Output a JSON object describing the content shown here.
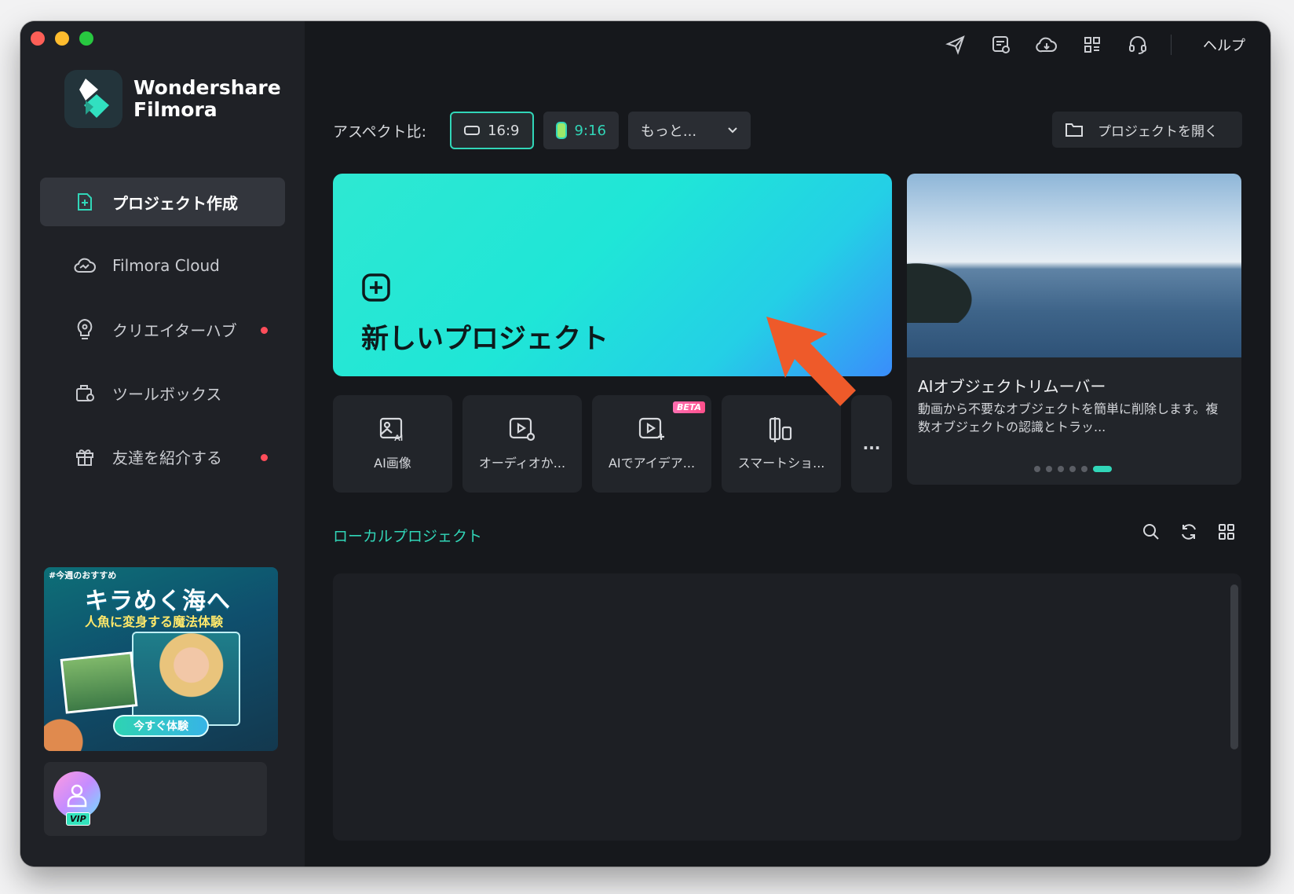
{
  "app": {
    "logo_line1": "Wondershare",
    "logo_line2": "Filmora"
  },
  "sidebar": {
    "items": [
      {
        "label": "プロジェクト作成",
        "icon": "new-project-icon",
        "active": true
      },
      {
        "label": "Filmora Cloud",
        "icon": "cloud-icon"
      },
      {
        "label": "クリエイターハブ",
        "icon": "lightbulb-icon",
        "notify": true
      },
      {
        "label": "ツールボックス",
        "icon": "toolbox-icon"
      },
      {
        "label": "友達を紹介する",
        "icon": "gift-icon",
        "notify": true
      }
    ],
    "promo": {
      "tag": "#今週のおすすめ",
      "title": "キラめく海へ",
      "subtitle": "人魚に変身する魔法体験",
      "button": "今すぐ体験"
    },
    "user": {
      "badge": "VIP"
    }
  },
  "topbar": {
    "icons": [
      "send-icon",
      "task-list-icon",
      "cloud-download-icon",
      "apps-grid-icon",
      "headset-icon"
    ],
    "help_label": "ヘルプ"
  },
  "aspect": {
    "label": "アスペクト比:",
    "options": [
      "16:9",
      "9:16"
    ],
    "more_label": "もっと..."
  },
  "open_project_label": "プロジェクトを開く",
  "new_project_label": "新しいプロジェクト",
  "tools": [
    {
      "label": "AI画像",
      "icon": "ai-image-icon"
    },
    {
      "label": "オーディオか...",
      "icon": "audio-video-icon"
    },
    {
      "label": "AIでアイデア...",
      "icon": "ai-idea-icon",
      "badge": "BETA"
    },
    {
      "label": "スマートショ...",
      "icon": "smart-short-icon"
    }
  ],
  "tools_more_label": "...",
  "feature": {
    "title": "AIオブジェクトリムーバー",
    "description": "動画から不要なオブジェクトを簡単に削除します。複数オブジェクトの認識とトラッ...",
    "slides": 6,
    "active_slide": 6
  },
  "local": {
    "title": "ローカルプロジェクト",
    "icons": [
      "search-icon",
      "refresh-icon",
      "grid-view-icon"
    ]
  },
  "colors": {
    "accent": "#31d6b8",
    "background": "#16181c",
    "sidebar": "#1f2126",
    "notify_dot": "#ff4d5a",
    "arrow": "#ee5a2a"
  }
}
